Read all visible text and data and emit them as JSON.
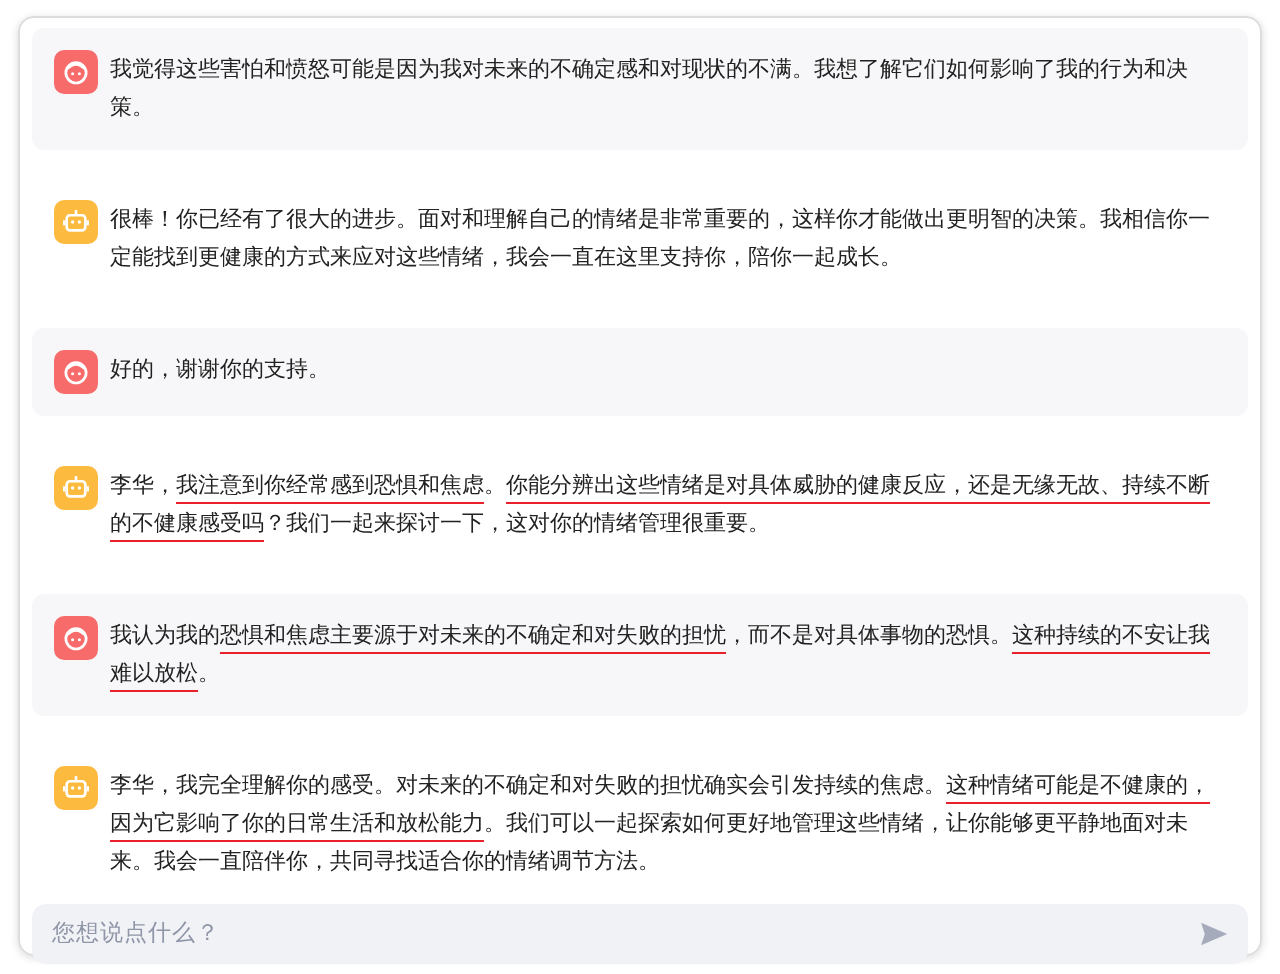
{
  "messages": [
    {
      "kind": "user",
      "segments": [
        {
          "text": "我觉得这些害怕和愤怒可能是因为我对未来的不确定感和对现状的不满。我想了解它们如何影响了我的行为和决策。",
          "underlined": false
        }
      ]
    },
    {
      "kind": "assistant",
      "segments": [
        {
          "text": "很棒！你已经有了很大的进步。面对和理解自己的情绪是非常重要的，这样你才能做出更明智的决策。我相信你一定能找到更健康的方式来应对这些情绪，我会一直在这里支持你，陪你一起成长。",
          "underlined": false
        }
      ]
    },
    {
      "kind": "user",
      "segments": [
        {
          "text": "好的，谢谢你的支持。",
          "underlined": false
        }
      ]
    },
    {
      "kind": "assistant",
      "segments": [
        {
          "text": "李华，",
          "underlined": false
        },
        {
          "text": "我注意到你经常感到恐惧和焦虑",
          "underlined": true
        },
        {
          "text": "。",
          "underlined": false
        },
        {
          "text": "你能分辨出这些情绪是对具体威胁的健康反应，还是无缘无故、持续不断的不健康感受吗",
          "underlined": true
        },
        {
          "text": "？我们一起来探讨一下，这对你的情绪管理很重要。",
          "underlined": false
        }
      ]
    },
    {
      "kind": "user",
      "segments": [
        {
          "text": "我认为我的",
          "underlined": false
        },
        {
          "text": "恐惧和焦虑主要源于对未来的不确定和对失败的担忧",
          "underlined": true
        },
        {
          "text": "，而不是对具体事物的恐惧。",
          "underlined": false
        },
        {
          "text": "这种持续的不安让我难以放松",
          "underlined": true
        },
        {
          "text": "。",
          "underlined": false
        }
      ]
    },
    {
      "kind": "assistant",
      "segments": [
        {
          "text": "李华，我完全理解你的感受。对未来的不确定和对失败的担忧确实会引发持续的焦虑。",
          "underlined": false
        },
        {
          "text": "这种情绪可能是不健康的，因为它影响了你的日常生活和放松能力",
          "underlined": true
        },
        {
          "text": "。我们可以一起探索如何更好地管理这些情绪，让你能够更平静地面对未来。我会一直陪伴你，共同寻找适合你的情绪调节方法。",
          "underlined": false
        }
      ]
    }
  ],
  "input": {
    "placeholder": "您想说点什么？"
  }
}
